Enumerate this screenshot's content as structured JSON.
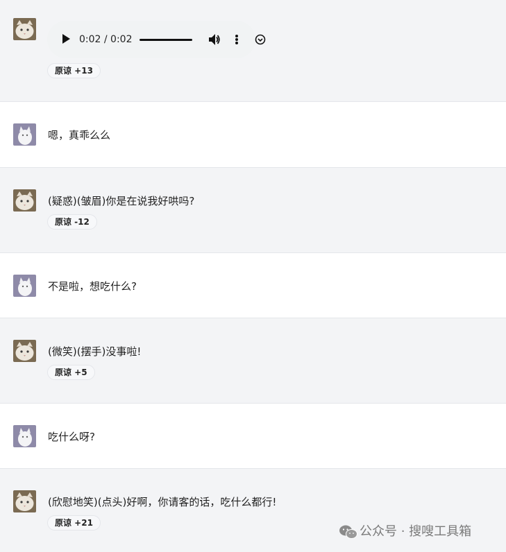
{
  "player": {
    "time": "0:02 / 0:02",
    "progress": 1.0
  },
  "messages": [
    {
      "speaker": "cat",
      "text": "",
      "badge": "原谅 +13"
    },
    {
      "speaker": "user",
      "text": "嗯，真乖么么"
    },
    {
      "speaker": "cat",
      "text": "(疑惑)(皱眉)你是在说我好哄吗?",
      "badge": "原谅 -12"
    },
    {
      "speaker": "user",
      "text": "不是啦，想吃什么?"
    },
    {
      "speaker": "cat",
      "text": "(微笑)(摆手)没事啦!",
      "badge": "原谅 +5"
    },
    {
      "speaker": "user",
      "text": "吃什么呀?"
    },
    {
      "speaker": "cat",
      "text": "(欣慰地笑)(点头)好啊，你请客的话，吃什么都行!",
      "badge": "原谅 +21"
    }
  ],
  "watermark": {
    "icon": "wechat-icon",
    "text": "公众号 · 搜嗖工具箱"
  },
  "colors": {
    "row_alt": "#f3f4f6",
    "row": "#ffffff",
    "badge_bg": "#f7f8fa",
    "divider": "#e4e6ea"
  }
}
